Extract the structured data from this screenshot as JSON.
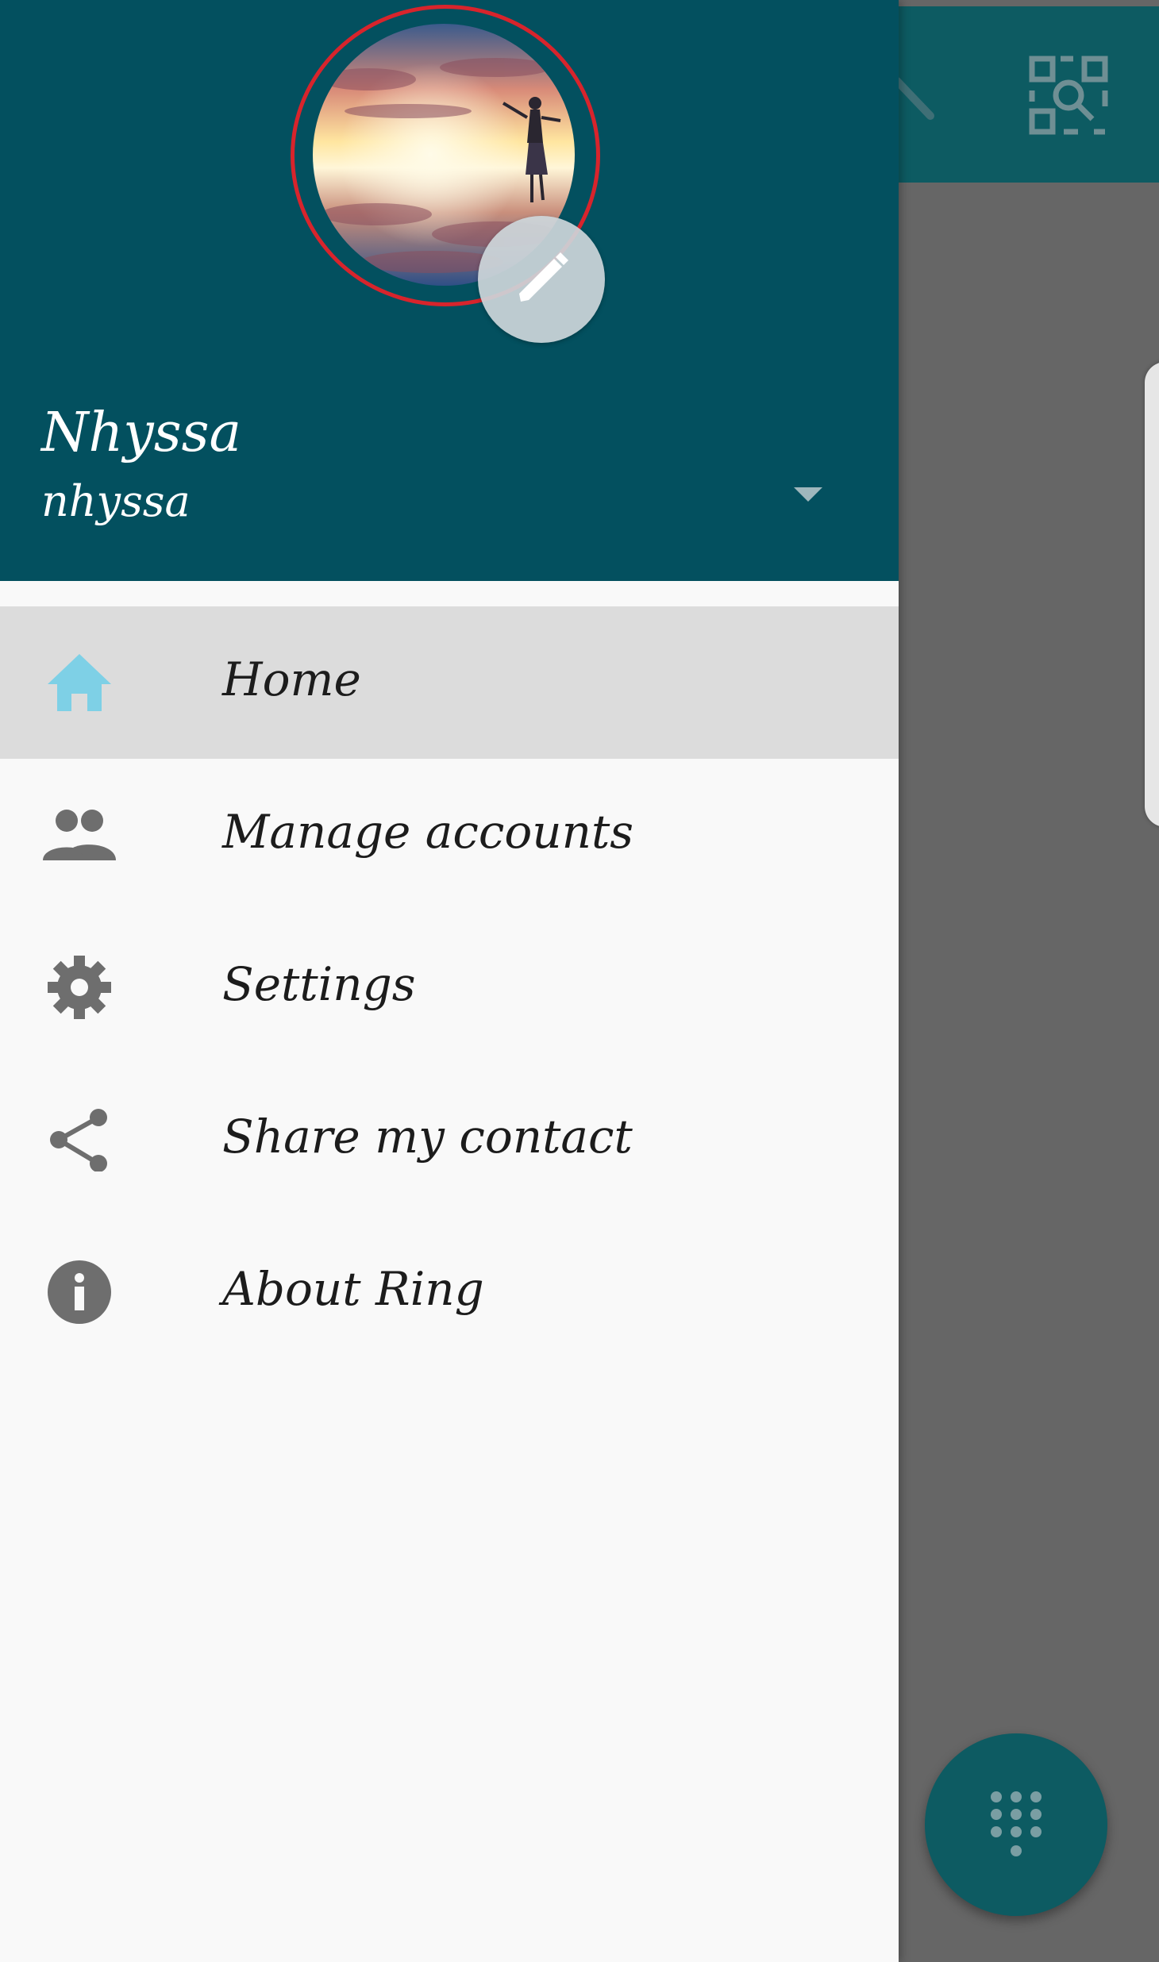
{
  "account": {
    "display_name": "Nhyssa",
    "username": "nhyssa"
  },
  "menu": {
    "items": [
      {
        "label": "Home",
        "icon": "home-icon",
        "active": true
      },
      {
        "label": "Manage accounts",
        "icon": "people-icon",
        "active": false
      },
      {
        "label": "Settings",
        "icon": "gear-icon",
        "active": false
      },
      {
        "label": "Share my contact",
        "icon": "share-icon",
        "active": false
      },
      {
        "label": "About Ring",
        "icon": "info-icon",
        "active": false
      }
    ]
  },
  "colors": {
    "header": "#03505f",
    "toolbar": "#0d5b62",
    "active_item": "#dcdcdc",
    "home_icon": "#7ed0e6",
    "menu_icon": "#6e6e6e",
    "annotation": "#d8242c"
  }
}
